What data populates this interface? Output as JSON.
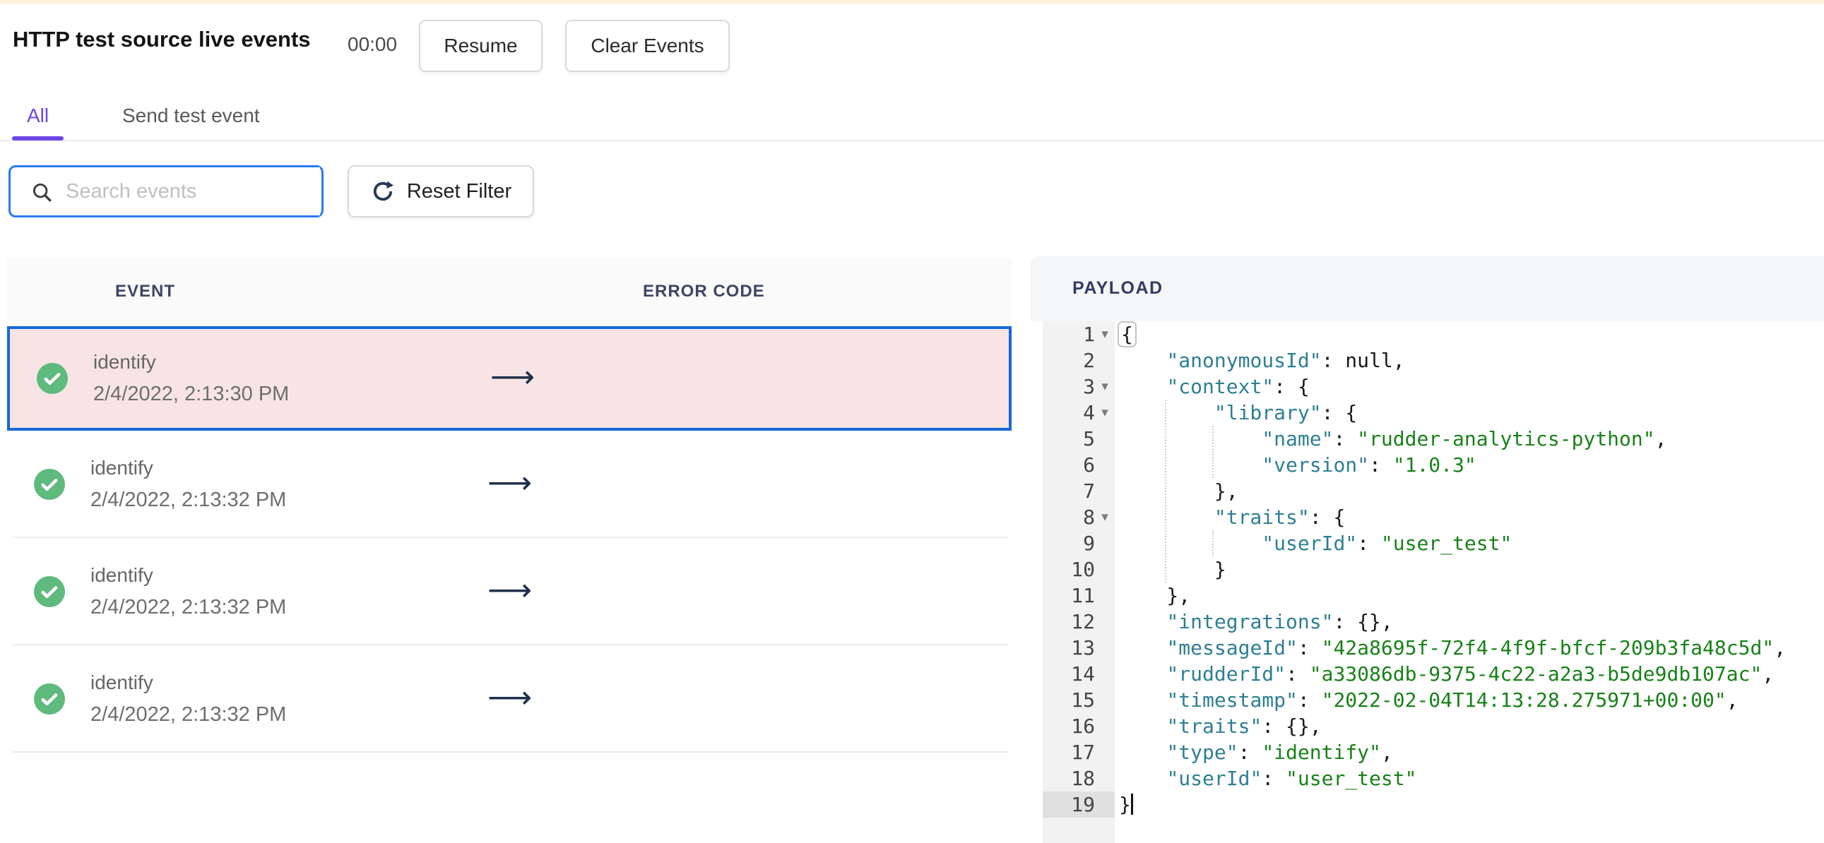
{
  "header": {
    "title": "HTTP test source live events",
    "timer": "00:00",
    "resume_label": "Resume",
    "clear_label": "Clear Events"
  },
  "tabs": {
    "items": [
      {
        "label": "All",
        "active": true
      },
      {
        "label": "Send test event",
        "active": false
      }
    ],
    "accent_color": "#6c47e6"
  },
  "filters": {
    "search_placeholder": "Search events",
    "search_icon": "magnifier",
    "reset_label": "Reset Filter",
    "reset_icon": "refresh"
  },
  "event_table": {
    "columns": [
      "EVENT",
      "ERROR CODE"
    ],
    "rows": [
      {
        "event": "identify",
        "time": "2/4/2022, 2:13:30 PM",
        "status": "success",
        "selected": true,
        "arrow": "⟶"
      },
      {
        "event": "identify",
        "time": "2/4/2022, 2:13:32 PM",
        "status": "success",
        "selected": false,
        "arrow": "⟶"
      },
      {
        "event": "identify",
        "time": "2/4/2022, 2:13:32 PM",
        "status": "success",
        "selected": false,
        "arrow": "⟶"
      },
      {
        "event": "identify",
        "time": "2/4/2022, 2:13:32 PM",
        "status": "success",
        "selected": false,
        "arrow": "⟶"
      }
    ],
    "selected_border_color": "#1568d9",
    "selected_bg_color": "#f8e4e4",
    "status_icon_color": "#5eba7d"
  },
  "payload": {
    "title": "PAYLOAD",
    "syntax_colors": {
      "key": "#2d7f93",
      "string": "#188218",
      "plain": "#1a1a1a"
    },
    "code_lines": [
      {
        "n": 1,
        "fold": true,
        "cur": false,
        "segs": [
          [
            "ph",
            "{"
          ]
        ]
      },
      {
        "n": 2,
        "fold": false,
        "cur": false,
        "segs": [
          [
            "p",
            "    "
          ],
          [
            "k",
            "\"anonymousId\""
          ],
          [
            "p",
            ": null,"
          ]
        ]
      },
      {
        "n": 3,
        "fold": true,
        "cur": false,
        "segs": [
          [
            "p",
            "    "
          ],
          [
            "k",
            "\"context\""
          ],
          [
            "p",
            ": {"
          ]
        ]
      },
      {
        "n": 4,
        "fold": true,
        "cur": false,
        "segs": [
          [
            "p",
            "        "
          ],
          [
            "k",
            "\"library\""
          ],
          [
            "p",
            ": {"
          ]
        ]
      },
      {
        "n": 5,
        "fold": false,
        "cur": false,
        "segs": [
          [
            "p",
            "            "
          ],
          [
            "k",
            "\"name\""
          ],
          [
            "p",
            ": "
          ],
          [
            "s",
            "\"rudder-analytics-python\""
          ],
          [
            "p",
            ","
          ]
        ]
      },
      {
        "n": 6,
        "fold": false,
        "cur": false,
        "segs": [
          [
            "p",
            "            "
          ],
          [
            "k",
            "\"version\""
          ],
          [
            "p",
            ": "
          ],
          [
            "s",
            "\"1.0.3\""
          ]
        ]
      },
      {
        "n": 7,
        "fold": false,
        "cur": false,
        "segs": [
          [
            "p",
            "        },"
          ]
        ]
      },
      {
        "n": 8,
        "fold": true,
        "cur": false,
        "segs": [
          [
            "p",
            "        "
          ],
          [
            "k",
            "\"traits\""
          ],
          [
            "p",
            ": {"
          ]
        ]
      },
      {
        "n": 9,
        "fold": false,
        "cur": false,
        "segs": [
          [
            "p",
            "            "
          ],
          [
            "k",
            "\"userId\""
          ],
          [
            "p",
            ": "
          ],
          [
            "s",
            "\"user_test\""
          ]
        ]
      },
      {
        "n": 10,
        "fold": false,
        "cur": false,
        "segs": [
          [
            "p",
            "        }"
          ]
        ]
      },
      {
        "n": 11,
        "fold": false,
        "cur": false,
        "segs": [
          [
            "p",
            "    },"
          ]
        ]
      },
      {
        "n": 12,
        "fold": false,
        "cur": false,
        "segs": [
          [
            "p",
            "    "
          ],
          [
            "k",
            "\"integrations\""
          ],
          [
            "p",
            ": {},"
          ]
        ]
      },
      {
        "n": 13,
        "fold": false,
        "cur": false,
        "segs": [
          [
            "p",
            "    "
          ],
          [
            "k",
            "\"messageId\""
          ],
          [
            "p",
            ": "
          ],
          [
            "s",
            "\"42a8695f-72f4-4f9f-bfcf-209b3fa48c5d\""
          ],
          [
            "p",
            ","
          ]
        ]
      },
      {
        "n": 14,
        "fold": false,
        "cur": false,
        "segs": [
          [
            "p",
            "    "
          ],
          [
            "k",
            "\"rudderId\""
          ],
          [
            "p",
            ": "
          ],
          [
            "s",
            "\"a33086db-9375-4c22-a2a3-b5de9db107ac\""
          ],
          [
            "p",
            ","
          ]
        ]
      },
      {
        "n": 15,
        "fold": false,
        "cur": false,
        "segs": [
          [
            "p",
            "    "
          ],
          [
            "k",
            "\"timestamp\""
          ],
          [
            "p",
            ": "
          ],
          [
            "s",
            "\"2022-02-04T14:13:28.275971+00:00\""
          ],
          [
            "p",
            ","
          ]
        ]
      },
      {
        "n": 16,
        "fold": false,
        "cur": false,
        "segs": [
          [
            "p",
            "    "
          ],
          [
            "k",
            "\"traits\""
          ],
          [
            "p",
            ": {},"
          ]
        ]
      },
      {
        "n": 17,
        "fold": false,
        "cur": false,
        "segs": [
          [
            "p",
            "    "
          ],
          [
            "k",
            "\"type\""
          ],
          [
            "p",
            ": "
          ],
          [
            "s",
            "\"identify\""
          ],
          [
            "p",
            ","
          ]
        ]
      },
      {
        "n": 18,
        "fold": false,
        "cur": false,
        "segs": [
          [
            "p",
            "    "
          ],
          [
            "k",
            "\"userId\""
          ],
          [
            "p",
            ": "
          ],
          [
            "s",
            "\"user_test\""
          ]
        ]
      },
      {
        "n": 19,
        "fold": false,
        "cur": true,
        "cursor": true,
        "segs": [
          [
            "p",
            "}"
          ]
        ]
      }
    ]
  },
  "page": {
    "top_strip_color": "#fdf3da"
  }
}
